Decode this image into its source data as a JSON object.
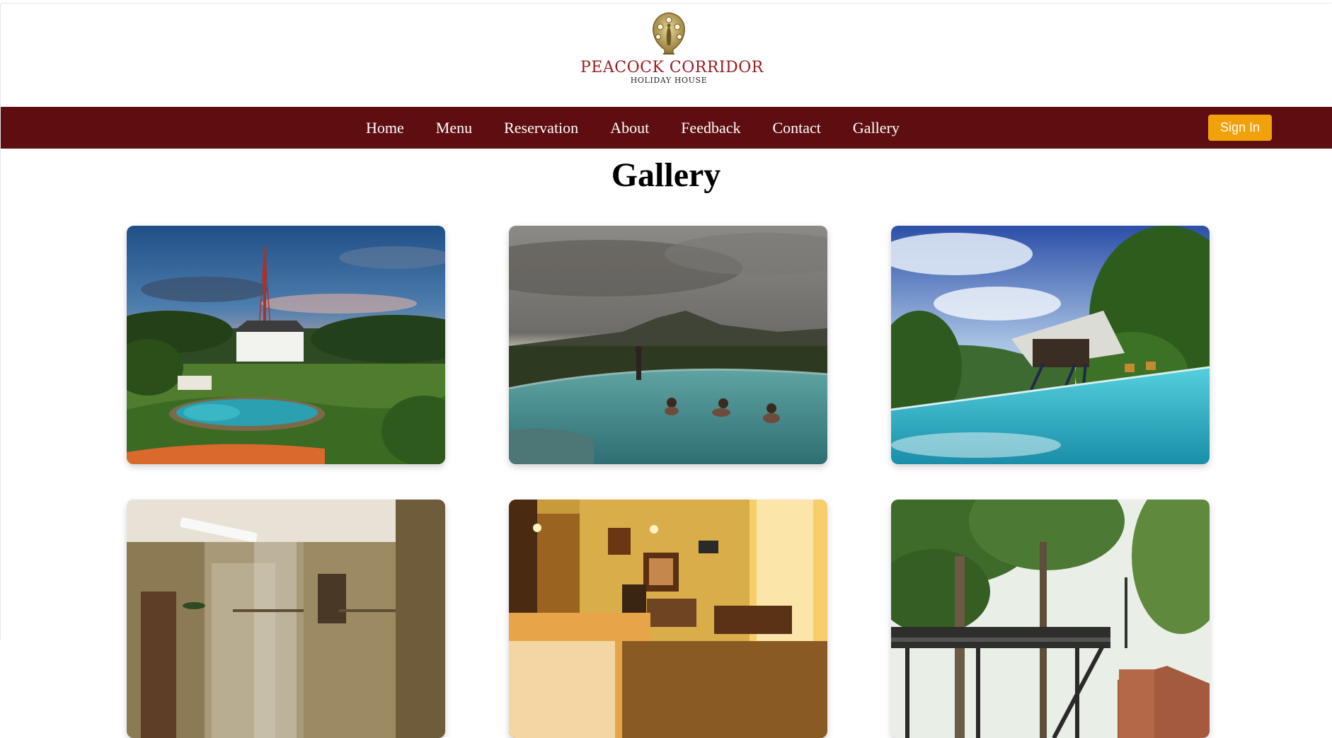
{
  "brand": {
    "name": "PEACOCK CORRIDOR",
    "subtitle": "HOLIDAY HOUSE",
    "logo_icon": "peacock-emblem-icon",
    "name_color": "#9b1b22",
    "emblem_color": "#b89b4a"
  },
  "nav": {
    "background": "#5e0e10",
    "items": [
      {
        "label": "Home"
      },
      {
        "label": "Menu"
      },
      {
        "label": "Reservation"
      },
      {
        "label": "About"
      },
      {
        "label": "Feedback"
      },
      {
        "label": "Contact"
      },
      {
        "label": "Gallery"
      }
    ],
    "signin_label": "Sign In",
    "signin_color": "#f1a20a"
  },
  "page": {
    "title": "Gallery"
  },
  "gallery": {
    "images": [
      {
        "subject": "aerial-resort-with-pool-photo"
      },
      {
        "subject": "infinity-pool-mountain-view-photo"
      },
      {
        "subject": "pool-with-treehouse-photo"
      },
      {
        "subject": "bathroom-interior-photo"
      },
      {
        "subject": "bedroom-interior-photo"
      },
      {
        "subject": "treehouse-exterior-photo"
      }
    ]
  }
}
